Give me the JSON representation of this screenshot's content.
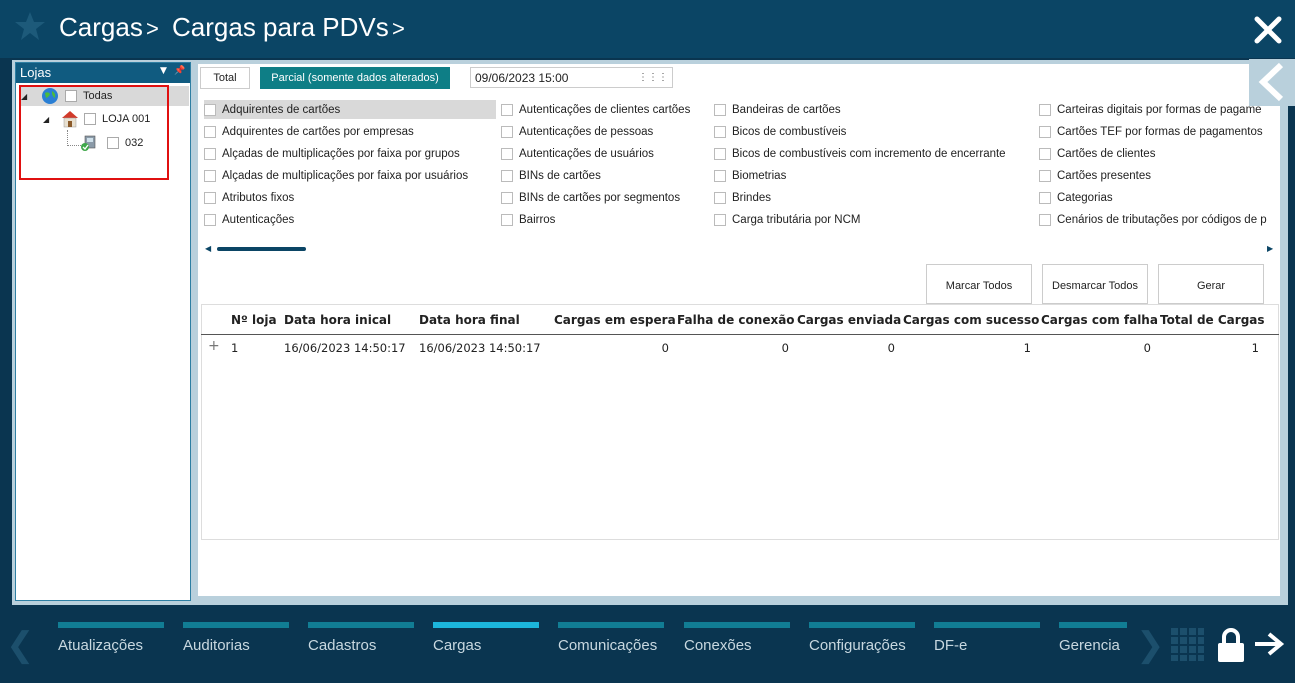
{
  "title": {
    "crumb1": "Cargas",
    "crumb2": "Cargas para PDVs",
    "sep": ">"
  },
  "left_panel": {
    "title": "Lojas",
    "tree": [
      {
        "label": "Todas",
        "level": 0
      },
      {
        "label": "LOJA 001",
        "level": 1
      },
      {
        "label": "032",
        "level": 2
      }
    ]
  },
  "mode": {
    "total_label": "Total",
    "parcial_label": "Parcial (somente dados alterados)",
    "date_value": "09/06/2023 15:00"
  },
  "checklist": {
    "col1": [
      "Adquirentes de cartões",
      "Adquirentes de cartões por empresas",
      "Alçadas de multiplicações por faixa por grupos",
      "Alçadas de multiplicações por faixa por usuários",
      "Atributos fixos",
      "Autenticações"
    ],
    "col2": [
      "Autenticações de clientes cartões",
      "Autenticações de pessoas",
      "Autenticações de usuários",
      "BINs de cartões",
      "BINs de cartões por segmentos",
      "Bairros"
    ],
    "col3": [
      "Bandeiras de cartões",
      "Bicos de combustíveis",
      "Bicos de combustíveis com incremento de encerrante",
      "Biometrias",
      "Brindes",
      "Carga tributária por NCM"
    ],
    "col4": [
      "Carteiras digitais por formas de pagame",
      "Cartões TEF por formas de pagamentos",
      "Cartões de clientes",
      "Cartões presentes",
      "Categorias",
      "Cenários de tributações por códigos de p"
    ]
  },
  "actions": {
    "marcar": "Marcar Todos",
    "desmarcar": "Desmarcar Todos",
    "gerar": "Gerar"
  },
  "grid": {
    "headers": [
      "Nº loja",
      "Data hora inical",
      "Data hora final",
      "Cargas em espera",
      "Falha de conexão",
      "Cargas enviada",
      "Cargas com sucesso",
      "Cargas com falha",
      "Total de Cargas"
    ],
    "rows": [
      {
        "expand": "+",
        "cells": [
          "1",
          "16/06/2023 14:50:17",
          "16/06/2023 14:50:17",
          "0",
          "0",
          "0",
          "1",
          "0",
          "1"
        ]
      }
    ]
  },
  "bottom_nav": {
    "items": [
      "Atualizações",
      "Auditorias",
      "Cadastros",
      "Cargas",
      "Comunicações",
      "Conexões",
      "Configurações",
      "DF-e",
      "Gerencia"
    ],
    "active": "Cargas"
  },
  "colors": {
    "title_bg": "#0b4565",
    "accent_teal": "#0e7e86",
    "nav_bar": "#117d94",
    "nav_active": "#1cb6dc",
    "highlight_box": "#e01010"
  }
}
